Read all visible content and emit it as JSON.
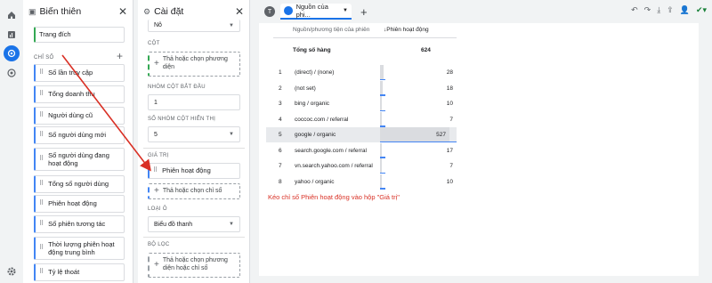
{
  "variables_panel": {
    "title": "Biến thiên",
    "top_dimension": "Trang đích",
    "metrics_label": "CHỈ SỐ",
    "metrics": [
      "Số lần truy cập",
      "Tổng doanh thu",
      "Người dùng cũ",
      "Số người dùng mới",
      "Số người dùng đang hoạt động",
      "Tổng số người dùng",
      "Phiên hoạt động",
      "Số phiên tương tác",
      "Thời lượng phiên hoạt động trung bình",
      "Tỷ lệ thoát"
    ]
  },
  "settings_panel": {
    "title": "Cài đặt",
    "top_select": "Nô",
    "columns_label": "CỘT",
    "columns_drop": "Thả hoặc chọn phương diện",
    "start_group_label": "NHÓM CỘT BẮT ĐẦU",
    "start_group_value": "1",
    "show_groups_label": "SỐ NHÓM CỘT HIỂN THỊ",
    "show_groups_value": "5",
    "values_label": "GIÁ TRỊ",
    "values_chip": "Phiên hoạt động",
    "values_drop": "Thả hoặc chọn chỉ số",
    "cell_type_label": "LOẠI Ô",
    "cell_type_value": "Biểu đồ thanh",
    "filter_label": "BỘ LỌC",
    "filter_drop": "Thả hoặc chọn phương diện hoặc chỉ số"
  },
  "tabs": {
    "avatar": "T",
    "active_tab": "Nguồn của phi...",
    "add": "+"
  },
  "table": {
    "dim_header": "Nguồn/phương tiện của phiên",
    "metric_header": "↓Phiên hoạt động",
    "total_label": "Tổng số hàng",
    "total_value": "624",
    "rows": [
      {
        "n": "1",
        "label": "(direct) / (none)",
        "value": "28",
        "frac": 0.053
      },
      {
        "n": "2",
        "label": "(not set)",
        "value": "18",
        "frac": 0.034
      },
      {
        "n": "3",
        "label": "bing / organic",
        "value": "10",
        "frac": 0.019
      },
      {
        "n": "4",
        "label": "coccoc.com / referral",
        "value": "7",
        "frac": 0.013
      },
      {
        "n": "5",
        "label": "google / organic",
        "value": "527",
        "frac": 1.0
      },
      {
        "n": "6",
        "label": "search.google.com / referral",
        "value": "17",
        "frac": 0.032
      },
      {
        "n": "7",
        "label": "vn.search.yahoo.com / referral",
        "value": "7",
        "frac": 0.013
      },
      {
        "n": "8",
        "label": "yahoo / organic",
        "value": "10",
        "frac": 0.019
      }
    ]
  },
  "instruction": "Kéo chỉ số Phiên hoạt động vào hộp \"Giá trị\"",
  "colors": {
    "accent": "#1a73e8",
    "annotation": "#d93025",
    "dimension": "#34a853",
    "metric": "#4285f4"
  }
}
